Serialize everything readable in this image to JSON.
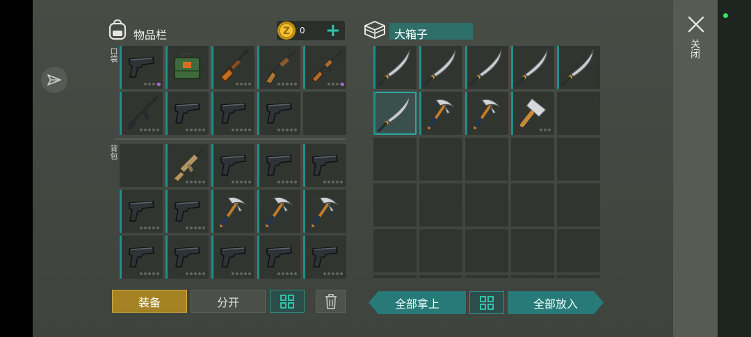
{
  "inventory": {
    "title": "物品栏",
    "coins": "0",
    "pocket_label": "口袋",
    "backpack_label": "背包",
    "pocket_slots": [
      {
        "item": "pistol",
        "dots": 4,
        "purple": true
      },
      {
        "item": "ammo-box",
        "dots": 0
      },
      {
        "item": "hunting-rifle",
        "dots": 4
      },
      {
        "item": "shotgun",
        "dots": 5
      },
      {
        "item": "assault-rifle",
        "dots": 4,
        "purple": true
      },
      {
        "item": "m16-rifle",
        "dots": 5
      },
      {
        "item": "pistol",
        "dots": 5
      },
      {
        "item": "pistol",
        "dots": 5
      },
      {
        "item": "pistol",
        "dots": 5
      },
      {
        "item": "empty"
      }
    ],
    "backpack_slots": [
      {
        "item": "empty"
      },
      {
        "item": "scar-rifle",
        "dots": 5
      },
      {
        "item": "pistol",
        "dots": 5
      },
      {
        "item": "pistol",
        "dots": 5
      },
      {
        "item": "pistol",
        "dots": 5
      },
      {
        "item": "pistol",
        "dots": 5
      },
      {
        "item": "pistol",
        "dots": 5
      },
      {
        "item": "pickaxe",
        "dots": 0
      },
      {
        "item": "pickaxe",
        "dots": 0
      },
      {
        "item": "pickaxe",
        "dots": 0
      },
      {
        "item": "pistol",
        "dots": 5
      },
      {
        "item": "pistol",
        "dots": 5
      },
      {
        "item": "pistol",
        "dots": 5
      },
      {
        "item": "pistol",
        "dots": 5
      },
      {
        "item": "pistol",
        "dots": 5
      }
    ]
  },
  "container": {
    "title": "大箱子",
    "slots": [
      {
        "item": "machete"
      },
      {
        "item": "machete"
      },
      {
        "item": "machete"
      },
      {
        "item": "machete"
      },
      {
        "item": "machete"
      },
      {
        "item": "machete",
        "selected": true
      },
      {
        "item": "pickaxe"
      },
      {
        "item": "pickaxe"
      },
      {
        "item": "cleaver",
        "dots": 3
      },
      {
        "item": "empty"
      },
      {
        "item": "empty"
      },
      {
        "item": "empty"
      },
      {
        "item": "empty"
      },
      {
        "item": "empty"
      },
      {
        "item": "empty"
      },
      {
        "item": "empty"
      },
      {
        "item": "empty"
      },
      {
        "item": "empty"
      },
      {
        "item": "empty"
      },
      {
        "item": "empty"
      },
      {
        "item": "empty"
      },
      {
        "item": "empty"
      },
      {
        "item": "empty"
      },
      {
        "item": "empty"
      },
      {
        "item": "empty"
      },
      {
        "item": "empty"
      },
      {
        "item": "empty"
      },
      {
        "item": "empty"
      },
      {
        "item": "empty"
      },
      {
        "item": "empty"
      }
    ]
  },
  "buttons": {
    "equip": "装备",
    "split": "分开",
    "take_all": "全部拿上",
    "put_all": "全部放入"
  },
  "sidebar": {
    "close": "关闭"
  },
  "colors": {
    "accent": "#2fc3a8",
    "equip": "#a58325",
    "teal_button": "#277a77"
  },
  "icons": [
    "backpack-icon",
    "gold-coin-icon",
    "plus-icon",
    "chest-icon",
    "sort-icon",
    "trash-icon",
    "close-icon",
    "compass-icon"
  ]
}
